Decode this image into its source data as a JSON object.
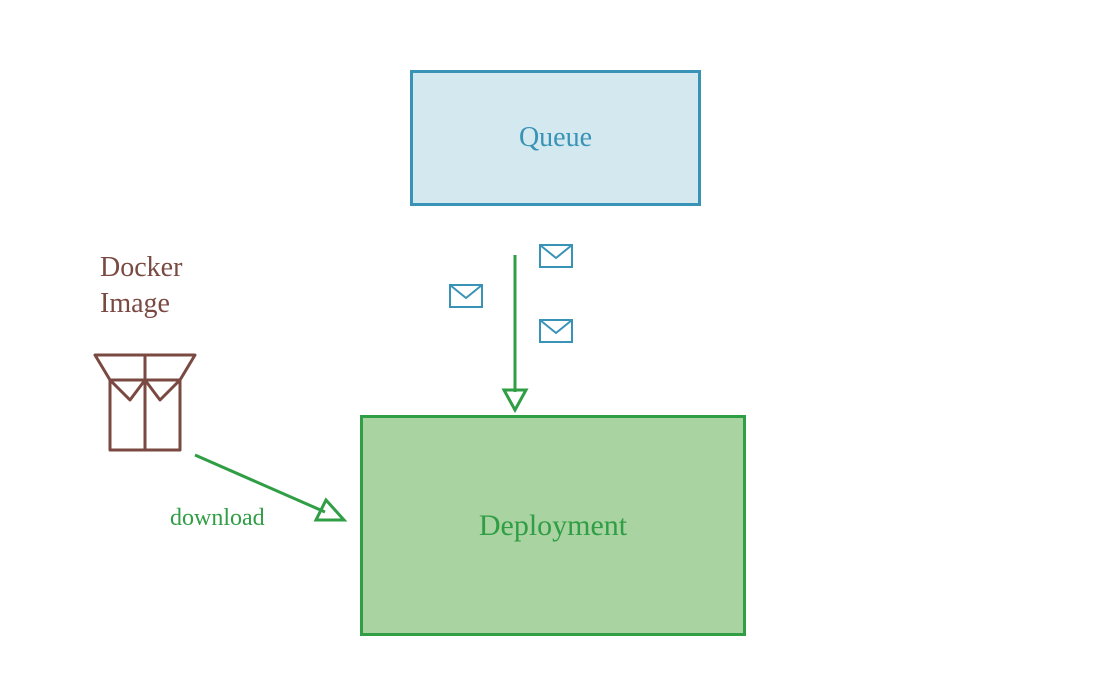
{
  "nodes": {
    "queue": {
      "label": "Queue"
    },
    "deployment": {
      "label": "Deployment"
    },
    "docker_image": {
      "label_line1": "Docker",
      "label_line2": "Image"
    }
  },
  "edges": {
    "queue_to_deployment": {
      "messages_count": 3
    },
    "docker_to_deployment": {
      "label": "download"
    }
  },
  "colors": {
    "blue_stroke": "#3993b7",
    "blue_fill": "#d3e9ef",
    "green_stroke": "#2f9e44",
    "green_fill": "#a9d3a1",
    "brown": "#7a4a42"
  }
}
